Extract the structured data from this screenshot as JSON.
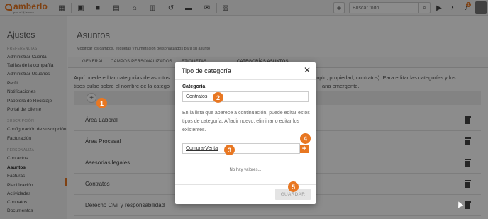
{
  "header": {
    "logo_text": "amberlo",
    "logo_sub": "part of ⓐ epona",
    "search_placeholder": "Buscar todo...",
    "notifications_count": "1",
    "brand_color": "#e87722",
    "icons": [
      "grid-icon",
      "contacts-icon",
      "briefcase-icon",
      "calendar-icon",
      "bank-icon",
      "documents-icon",
      "history-icon",
      "chat-icon",
      "mail-icon",
      "reports-icon",
      "plus-icon",
      "search-icon",
      "play-icon",
      "timer-icon",
      "bell-icon",
      "avatar"
    ]
  },
  "sidebar": {
    "title": "Ajustes",
    "sections": [
      {
        "label": "PREFERENCIAS",
        "items": [
          "Administrar Cuenta",
          "Tarifas de la compañía",
          "Administrar Usuarios",
          "Perfil",
          "Notificaciones",
          "Papelera de Reciclaje",
          "Portal del cliente"
        ]
      },
      {
        "label": "SUSCRIPCIÓN",
        "items": [
          "Configuración de suscripción",
          "Facturación"
        ]
      },
      {
        "label": "PERSONALIZA",
        "items": [
          "Contactos",
          "Asuntos",
          "Facturas",
          "Planificación",
          "Actividades",
          "Contratos",
          "Documentos"
        ]
      }
    ],
    "active_item": "Asuntos"
  },
  "main": {
    "title": "Asuntos",
    "subtitle": "Modificar los campos, etiquetas y numeración personalizados para su asunto",
    "tabs": [
      "GENERAL",
      "CAMPOS PERSONALIZADOS",
      "ETIQUETAS",
      "CATEGORÍAS ASUNTOS"
    ],
    "intro_left": "Aquí puede editar categorías de asuntos",
    "intro_right": "ejemplo, propiedad, contratos). Para editar las categorías y los",
    "intro_left2": "tipos pulse sobre el nombre de la catego",
    "intro_right2": "ana emergente.",
    "add_label": "+",
    "categories": [
      "Área Laboral",
      "Área Procesal",
      "Asesorías legales",
      "Contratos",
      "Derecho Civil y responsabilidad"
    ]
  },
  "modal": {
    "title": "Tipo de categoría",
    "close_label": "✕",
    "category_label": "Categoría",
    "category_value": "Contratos",
    "description": "En la lista que aparece a continuación, puede editar estos tipos de categoría. Añadir nuevo, eliminar o editar los existentes.",
    "new_item_value": "Compra-Venta",
    "add_item_label": "+",
    "empty_text": "No hay valores...",
    "save_label": "GUARDAR"
  },
  "steps": [
    "1",
    "2",
    "3",
    "4",
    "5"
  ]
}
